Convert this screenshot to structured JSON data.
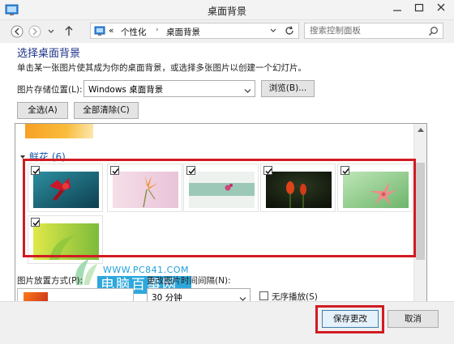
{
  "window": {
    "title": "桌面背景"
  },
  "address": {
    "prefix": "«",
    "crumbs": [
      "个性化",
      "桌面背景"
    ],
    "search_placeholder": "搜索控制面板"
  },
  "page": {
    "heading": "选择桌面背景",
    "description": "单击某一张图片使其成为你的桌面背景，或选择多张图片以创建一个幻灯片。",
    "location_label": "图片存储位置(L):",
    "location_value": "Windows 桌面背景",
    "browse_label": "浏览(B)...",
    "select_all_label": "全选(A)",
    "clear_all_label": "全部清除(C)"
  },
  "gallery": {
    "group_label": "鲜花 (6)",
    "items": [
      {
        "name": "flower-1",
        "checked": true
      },
      {
        "name": "flower-2",
        "checked": true
      },
      {
        "name": "flower-3",
        "checked": true
      },
      {
        "name": "flower-4",
        "checked": true
      },
      {
        "name": "flower-5",
        "checked": true
      },
      {
        "name": "flower-6",
        "checked": true
      }
    ]
  },
  "watermark": {
    "url": "WWW.PC841.COM",
    "name": "电脑百事网"
  },
  "options": {
    "position_label": "图片放置方式(P):",
    "interval_label": "更改图片时间间隔(N):",
    "interval_value": "30 分钟",
    "shuffle_label": "无序播放(S)",
    "shuffle_checked": false
  },
  "footer": {
    "save_label": "保存更改",
    "cancel_label": "取消"
  },
  "colors": {
    "heading": "#1e3287",
    "group": "#1c5ab0",
    "highlight": "#d11b22",
    "watermark": "#2ea8dc"
  }
}
